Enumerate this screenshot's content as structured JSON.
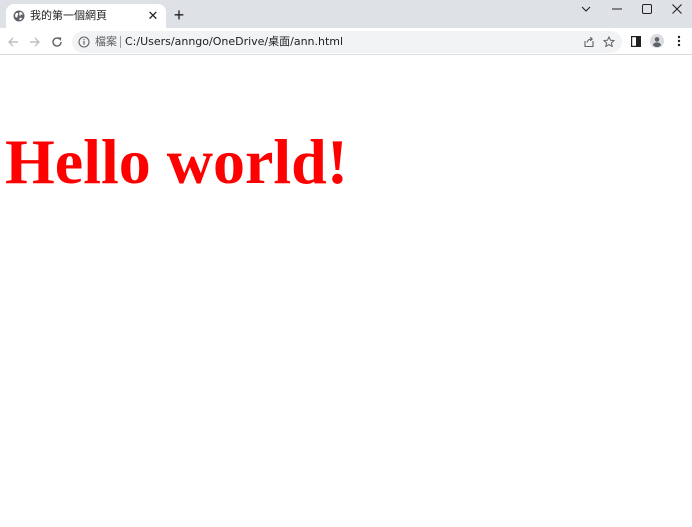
{
  "browser": {
    "tab": {
      "title": "我的第一個網頁",
      "favicon": "globe-icon",
      "close_icon": "close-icon"
    },
    "new_tab_icon": "plus-icon",
    "window_controls": [
      "chevron-down-icon",
      "minimize-icon",
      "maximize-icon",
      "close-icon"
    ],
    "toolbar": {
      "back_icon": "arrow-left-icon",
      "forward_icon": "arrow-right-icon",
      "reload_icon": "reload-icon",
      "address": {
        "scheme_label": "檔案",
        "url": "C:/Users/anngo/OneDrive/桌面/ann.html"
      },
      "icons": [
        "share-icon",
        "star-icon",
        "side-panel-icon",
        "profile-icon",
        "menu-icon"
      ]
    }
  },
  "page": {
    "heading": "Hello world!",
    "heading_color": "#ff0000"
  },
  "colors": {
    "tabstrip_bg": "#dee1e6",
    "omnibox_bg": "#f1f3f4"
  }
}
